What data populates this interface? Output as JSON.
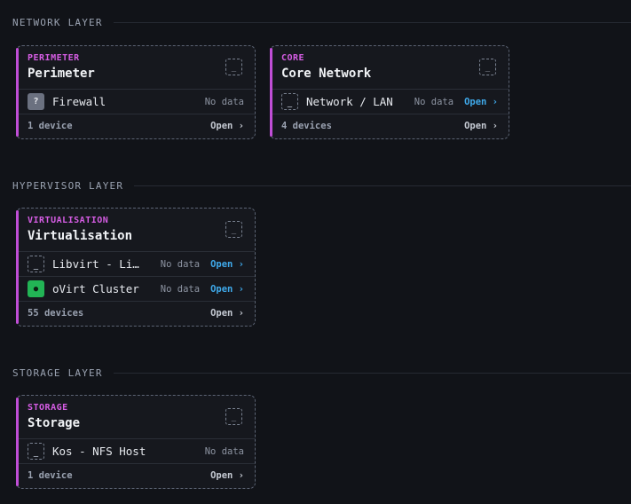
{
  "layers": [
    {
      "title": "NETWORK LAYER",
      "cards": [
        {
          "kicker": "PERIMETER",
          "title": "Perimeter",
          "menu_glyph": "_",
          "rows": [
            {
              "status": "unknown",
              "status_glyph": "?",
              "name": "Firewall",
              "value": "No data",
              "open": ""
            }
          ],
          "count": "1 device",
          "open": "Open ›"
        },
        {
          "kicker": "CORE",
          "title": "Core Network",
          "menu_glyph": "_",
          "rows": [
            {
              "status": "none",
              "status_glyph": "_",
              "name": "Network / LAN",
              "value": "No data",
              "open": "Open ›"
            }
          ],
          "count": "4 devices",
          "open": "Open ›"
        }
      ]
    },
    {
      "title": "HYPERVISOR LAYER",
      "cards": [
        {
          "kicker": "VIRTUALISATION",
          "title": "Virtualisation",
          "menu_glyph": "_",
          "rows": [
            {
              "status": "none",
              "status_glyph": "_",
              "name": "Libvirt - Li…",
              "value": "No data",
              "open": "Open ›"
            },
            {
              "status": "ok",
              "status_glyph": "●",
              "name": "oVirt Cluster",
              "value": "No data",
              "open": "Open ›"
            }
          ],
          "count": "55 devices",
          "open": "Open ›"
        }
      ]
    },
    {
      "title": "STORAGE LAYER",
      "cards": [
        {
          "kicker": "STORAGE",
          "title": "Storage",
          "menu_glyph": "_",
          "rows": [
            {
              "status": "none",
              "status_glyph": "_",
              "name": "Kos - NFS Host",
              "value": "No data",
              "open": ""
            }
          ],
          "count": "1 device",
          "open": "Open ›"
        }
      ]
    }
  ],
  "colors": {
    "accent": "#c04ed6",
    "link": "#3fa9ea",
    "status_ok": "#22b455",
    "status_unknown": "#6b7180"
  }
}
